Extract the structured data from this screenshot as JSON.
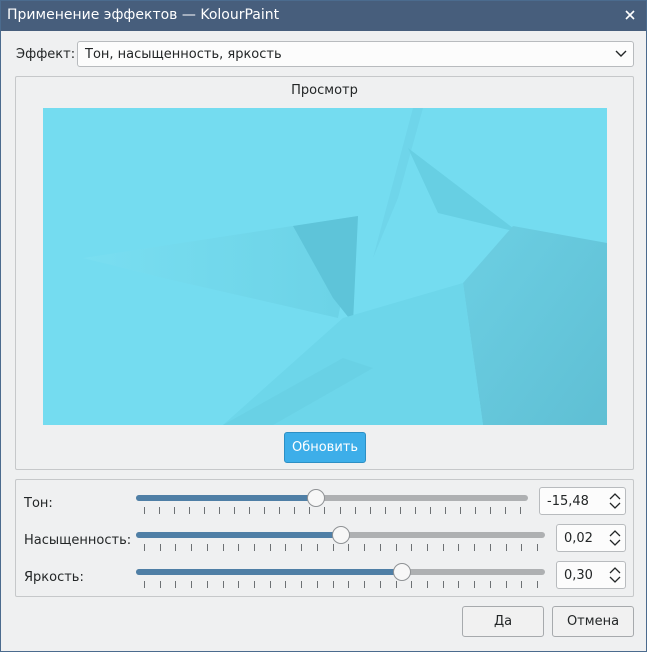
{
  "window": {
    "title": "Применение эффектов — KolourPaint"
  },
  "effect": {
    "label": "Эффект:",
    "selected": "Тон, насыщенность, яркость"
  },
  "preview": {
    "title": "Просмотр",
    "refresh_label": "Обновить",
    "background_color": "#73dbef"
  },
  "sliders": [
    {
      "label": "Тон:",
      "value_text": "-15,48",
      "value": -15.48,
      "level": 0.46
    },
    {
      "label": "Насыщенность:",
      "value_text": "0,02",
      "value": 0.02,
      "level": 0.5
    },
    {
      "label": "Яркость:",
      "value_text": "0,30",
      "value": 0.3,
      "level": 0.65
    }
  ],
  "buttons": {
    "ok": "Да",
    "cancel": "Отмена"
  },
  "colors": {
    "accent": "#3daee9",
    "titlebar": "#475e7c",
    "slider_fill": "#4f7fa6"
  }
}
